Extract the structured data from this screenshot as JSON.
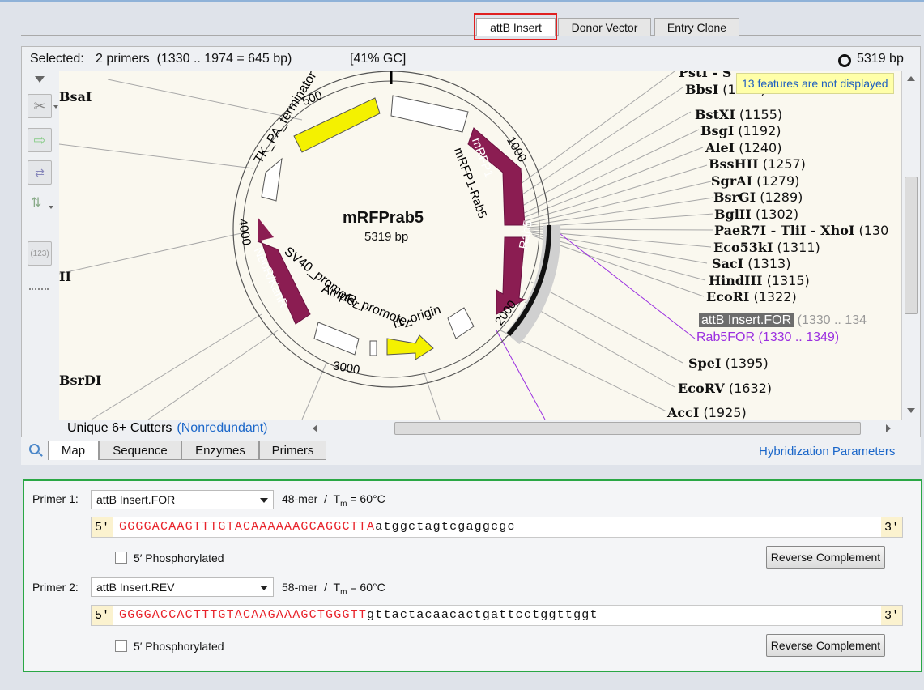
{
  "top_tabs": [
    "attB Insert",
    "Donor Vector",
    "Entry Clone"
  ],
  "status": {
    "selected_label": "Selected:",
    "selected_value": "2 primers  (1330 .. 1974 = 645 bp)",
    "gc": "[41% GC]",
    "length": "5319 bp"
  },
  "map": {
    "name": "mRFPrab5",
    "size": "5319 bp",
    "tooltip": "13 features are not displayed",
    "ticks": [
      "500",
      "1000",
      "2000",
      "3000",
      "4000"
    ],
    "features": [
      "TK_PA_terminator",
      "mRFP1",
      "mRFP1-Rab5",
      "Rab5",
      "NeoR/KanR",
      "SV40_promoter",
      "AmpR_promoter",
      "f1_origin"
    ],
    "left_enzymes": [
      "BsaI",
      "II",
      "BsrDI"
    ],
    "right_enzymes": [
      {
        "name": "PstI - S",
        "pos": ""
      },
      {
        "name": "BbsI",
        "pos": "(1083)"
      },
      {
        "name": "BstXI",
        "pos": "(1155)"
      },
      {
        "name": "BsgI",
        "pos": "(1192)"
      },
      {
        "name": "AleI",
        "pos": "(1240)"
      },
      {
        "name": "BssHII",
        "pos": "(1257)"
      },
      {
        "name": "SgrAI",
        "pos": "(1279)"
      },
      {
        "name": "BsrGI",
        "pos": "(1289)"
      },
      {
        "name": "BglII",
        "pos": "(1302)"
      },
      {
        "name": "PaeR7I - TliI - XhoI",
        "pos": "(130"
      },
      {
        "name": "Eco53kI",
        "pos": "(1311)"
      },
      {
        "name": "SacI",
        "pos": "(1313)"
      },
      {
        "name": "HindIII",
        "pos": "(1315)"
      },
      {
        "name": "EcoRI",
        "pos": "(1322)"
      },
      {
        "name": "SpeI",
        "pos": "(1395)"
      },
      {
        "name": "EcoRV",
        "pos": "(1632)"
      },
      {
        "name": "AccI",
        "pos": "(1925)"
      }
    ],
    "primer_labels": [
      {
        "name": "attB Insert.FOR",
        "pos": "(1330 .. 134"
      },
      {
        "name": "Rab5FOR",
        "pos": "(1330 .. 1349)"
      }
    ],
    "cutter_filter": "Unique 6+ Cutters",
    "cutter_mode": "(Nonredundant)"
  },
  "bottom_tabs": [
    "Map",
    "Sequence",
    "Enzymes",
    "Primers"
  ],
  "hybridization_link": "Hybridization Parameters",
  "primers": [
    {
      "label": "Primer 1:",
      "name": "attB Insert.FOR",
      "mer": "48-mer",
      "tm": "= 60°C",
      "end5": "5′",
      "end3": "3′",
      "seq_upper": "GGGGACAAGTTTGTACAAAAAAGCAGGCTTA",
      "seq_lower": "atggctagtcgaggcgc",
      "phospho": "5′ Phosphorylated",
      "button": "Reverse Complement"
    },
    {
      "label": "Primer 2:",
      "name": "attB Insert.REV",
      "mer": "58-mer",
      "tm": "= 60°C",
      "end5": "5′",
      "end3": "3′",
      "seq_upper": "GGGGACCACTTTGTACAAGAAAGCTGGGTT",
      "seq_lower": "gttactacaacactgattcctggttggt",
      "phospho": "5′ Phosphorylated",
      "button": "Reverse Complement"
    }
  ],
  "colors": {
    "accent_red": "#e02020",
    "green_frame": "#2aa745",
    "feature_magenta": "#8b1d52",
    "feature_yellow": "#f4f100",
    "primer_purple": "#9b2fe0",
    "link_blue": "#1a66c9"
  }
}
